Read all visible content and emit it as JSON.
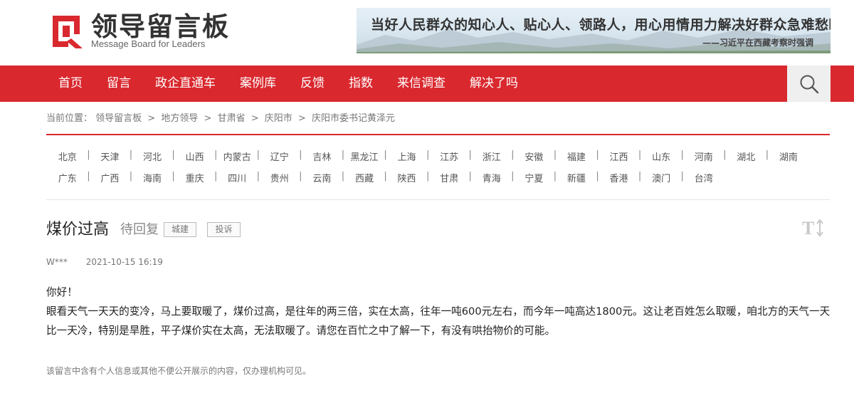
{
  "header": {
    "logo_title": "领导留言板",
    "logo_subtitle": "Message Board for Leaders",
    "banner_quote": "当好人民群众的知心人、贴心人、领路人，用心用情用力解决好群众急难愁盼问题。",
    "banner_attribution": "——习近平在西藏考察时强调"
  },
  "nav": {
    "items": [
      "首页",
      "留言",
      "政企直通车",
      "案例库",
      "反馈",
      "指数",
      "来信调查",
      "解决了吗"
    ],
    "search_icon": "search-icon"
  },
  "breadcrumb": {
    "prefix": "当前位置：",
    "items": [
      "领导留言板",
      "地方领导",
      "甘肃省",
      "庆阳市",
      "庆阳市委书记黄泽元"
    ],
    "separator": ">"
  },
  "provinces": {
    "row1": [
      "北京",
      "天津",
      "河北",
      "山西",
      "内蒙古",
      "辽宁",
      "吉林",
      "黑龙江",
      "上海",
      "江苏",
      "浙江",
      "安徽",
      "福建",
      "江西",
      "山东",
      "河南",
      "湖北",
      "湖南"
    ],
    "row2": [
      "广东",
      "广西",
      "海南",
      "重庆",
      "四川",
      "贵州",
      "云南",
      "西藏",
      "陕西",
      "甘肃",
      "青海",
      "宁夏",
      "新疆",
      "香港",
      "澳门",
      "台湾"
    ]
  },
  "message": {
    "title": "煤价过高",
    "status": "待回复",
    "tag_type": "城建",
    "tag_category": "投诉",
    "author": "W***",
    "date": "2021-10-15 16:19",
    "greeting": "你好！",
    "body": "眼看天气一天天的变冷，马上要取暖了，煤价过高，是往年的两三倍，实在太高，往年一吨600元左右，而今年一吨高达1800元。这让老百姓怎么取暖，咱北方的天气一天比一天冷，特别是旱胜，平子煤价实在太高，无法取暖了。请您在百忙之中了解一下，有没有哄抬物价的可能。",
    "privacy_note": "该留言中含有个人信息或其他不便公开展示的内容，仅办理机构可见。",
    "font_size_icon": "font-size-icon"
  },
  "colors": {
    "brand_red": "#d9282e",
    "search_bg": "#efefef"
  }
}
